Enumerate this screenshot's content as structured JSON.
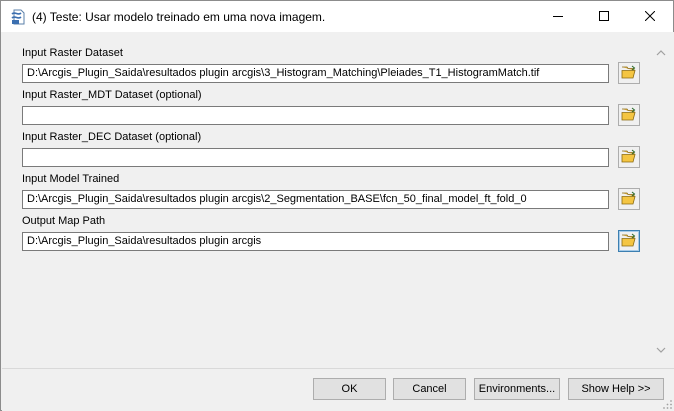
{
  "window": {
    "title": "(4) Teste: Usar modelo treinado em uma nova imagem.",
    "app_icon": "python-script-icon",
    "controls": {
      "minimize": "minimize-icon",
      "maximize": "maximize-icon",
      "close": "close-icon"
    }
  },
  "form": {
    "fields": [
      {
        "label": "Input Raster Dataset",
        "value": "D:\\Arcgis_Plugin_Saida\\resultados plugin arcgis\\3_Histogram_Matching\\Pleiades_T1_HistogramMatch.tif"
      },
      {
        "label": "Input Raster_MDT Dataset (optional)",
        "value": ""
      },
      {
        "label": "Input Raster_DEC Dataset (optional)",
        "value": ""
      },
      {
        "label": "Input Model Trained",
        "value": "D:\\Arcgis_Plugin_Saida\\resultados plugin arcgis\\2_Segmentation_BASE\\fcn_50_final_model_ft_fold_0"
      },
      {
        "label": "Output Map Path",
        "value": "D:\\Arcgis_Plugin_Saida\\resultados plugin arcgis"
      }
    ],
    "browse_icon": "open-folder-icon"
  },
  "buttons": {
    "ok": "OK",
    "cancel": "Cancel",
    "environments": "Environments...",
    "show_help": "Show Help >>"
  },
  "colors": {
    "accent_focus": "#3c7fb1",
    "folder_yellow": "#f4c542"
  }
}
